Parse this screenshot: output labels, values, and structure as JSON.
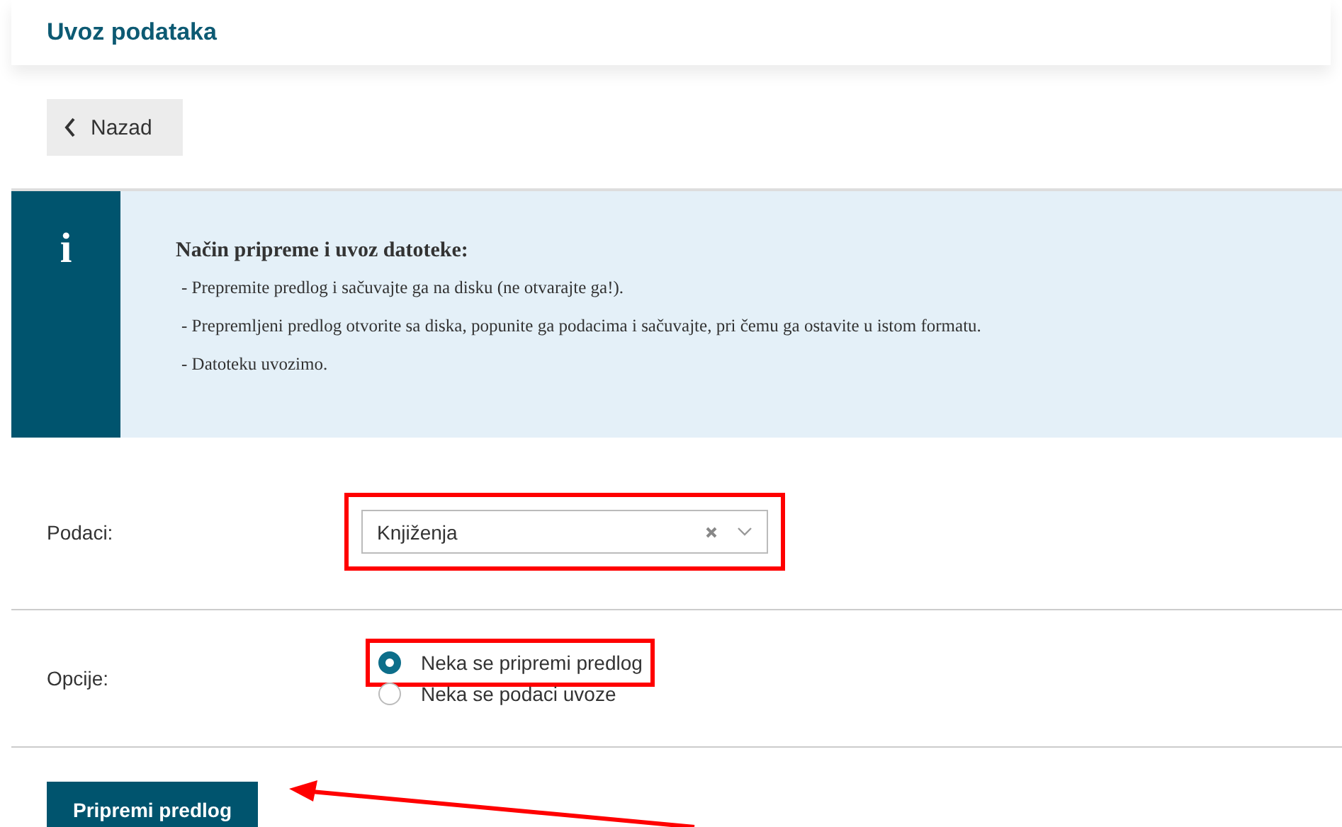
{
  "header": {
    "title": "Uvoz podataka"
  },
  "back_button": {
    "label": "Nazad"
  },
  "info": {
    "icon": "i",
    "title": "Način pripreme i uvoz datoteke:",
    "items": [
      "- Prepremite predlog i sačuvajte ga na disku (ne otvarajte ga!).",
      "- Prepremljeni predlog otvorite sa diska, popunite ga podacima i sačuvajte, pri čemu ga ostavite u istom formatu.",
      "- Datoteku uvozimo."
    ]
  },
  "form": {
    "data_label": "Podaci:",
    "data_value": "Knjiženja",
    "data_highlighted": true,
    "options_label": "Opcije:",
    "options": [
      {
        "label": "Neka se pripremi predlog",
        "selected": true,
        "highlighted": true
      },
      {
        "label": "Neka se podaci uvoze",
        "selected": false,
        "highlighted": false
      }
    ]
  },
  "submit": {
    "label": "Pripremi predlog",
    "pointed_at": true
  }
}
